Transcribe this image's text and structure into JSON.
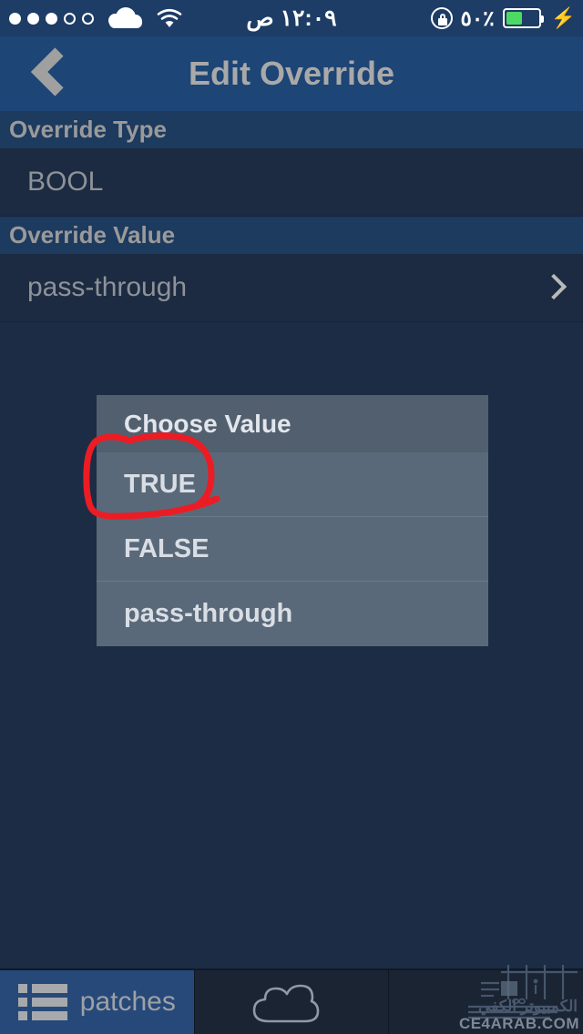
{
  "status_bar": {
    "signal_dots_filled": 3,
    "signal_dots_total": 5,
    "carrier_icon": "cloud-icon",
    "wifi_icon": "wifi-icon",
    "time": "١٢:٠٩ ص",
    "rotation_lock_icon": "rotation-lock-icon",
    "battery_percent": "٪٥٠",
    "battery_level": 45,
    "charging_icon": "lightning-bolt-icon",
    "battery_color": "#4cd964",
    "background_color": "#1d3c66"
  },
  "nav_bar": {
    "back_icon": "chevron-left-icon",
    "title": "Edit Override",
    "background_color": "#1d4576",
    "title_color": "#a9a9a9"
  },
  "sections": [
    {
      "header": "Override Type",
      "rows": [
        {
          "label": "BOOL",
          "has_chevron": false
        }
      ]
    },
    {
      "header": "Override Value",
      "rows": [
        {
          "label": "pass-through",
          "has_chevron": true,
          "chevron_icon": "chevron-right-icon"
        }
      ]
    }
  ],
  "dialog": {
    "title": "Choose Value",
    "options": [
      {
        "label": "TRUE"
      },
      {
        "label": "FALSE"
      },
      {
        "label": "pass-through"
      }
    ],
    "background_color": "#5a6979",
    "header_color": "#525f6e"
  },
  "annotation": {
    "type": "hand-drawn-circle",
    "target": "TRUE",
    "color": "#ec1c24"
  },
  "tab_bar": {
    "tabs": [
      {
        "label": "patches",
        "icon": "list-icon",
        "active": true
      },
      {
        "label": "",
        "icon": "cloud-icon",
        "active": false
      },
      {
        "label": "",
        "icon": "",
        "active": false
      }
    ],
    "active_color": "#26497a",
    "background_color": "#1b2433"
  },
  "watermark": {
    "arabic": "الكمبيوتر الكفي",
    "url": "CE4ARAB.COM"
  }
}
